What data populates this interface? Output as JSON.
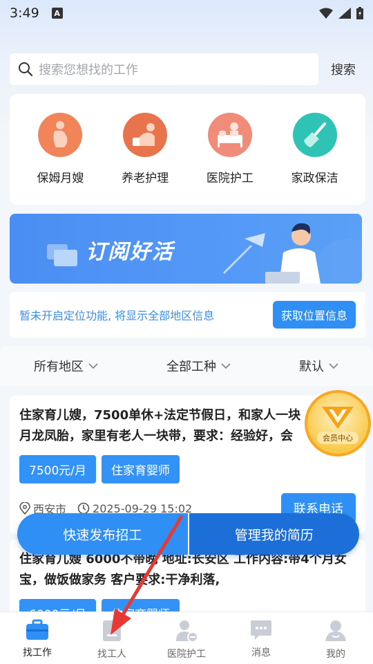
{
  "status": {
    "time": "3:49",
    "notification_glyph": "A"
  },
  "search": {
    "placeholder": "搜索您想找的工作",
    "button_label": "搜索"
  },
  "categories": [
    {
      "label": "保姆月嫂",
      "icon": "pregnant-woman-icon",
      "color": "#f2845a"
    },
    {
      "label": "养老护理",
      "icon": "elderly-care-icon",
      "color": "#e7744c"
    },
    {
      "label": "医院护工",
      "icon": "hospital-bed-icon",
      "color": "#f28c7a"
    },
    {
      "label": "家政保洁",
      "icon": "broom-icon",
      "color": "#2fc3b6"
    }
  ],
  "banner": {
    "title": "订阅好活"
  },
  "location": {
    "message": "暂未开启定位功能, 将显示全部地区信息",
    "button_label": "获取位置信息"
  },
  "filters": [
    {
      "label": "所有地区"
    },
    {
      "label": "全部工种"
    },
    {
      "label": "默认"
    }
  ],
  "jobs": [
    {
      "title_line1": "住家育儿嫂，7500单休+法定节假日，和家人一块",
      "title_line2": "月龙凤胎，家里有老人一块带，要求：经验好，会",
      "tags": [
        "7500元/月",
        "住家育婴师"
      ],
      "location": "西安市",
      "time": "2025-09-29 15:02",
      "call_label": "联系电话"
    },
    {
      "title_line1": "住家育儿嫂 6000不带晚 地址:长安区 工作内容:带4个月女",
      "title_line2": "宝，做饭做家务 客户要求:干净利落,",
      "tags": [
        "6000元/月",
        "住家育婴师"
      ]
    }
  ],
  "vip": {
    "label": "会员中心"
  },
  "actions": {
    "post_label": "快速发布招工",
    "resume_label": "管理我的简历"
  },
  "tabs": [
    {
      "label": "找工作",
      "icon": "briefcase-icon"
    },
    {
      "label": "找工人",
      "icon": "worker-card-icon"
    },
    {
      "label": "医院护工",
      "icon": "nurse-icon"
    },
    {
      "label": "消息",
      "icon": "chat-icon"
    },
    {
      "label": "我的",
      "icon": "user-icon"
    }
  ],
  "colors": {
    "primary": "#2f8ff5",
    "primary_dark": "#1c6fd8",
    "accent_orange": "#f9a825",
    "arrow": "#e53935"
  }
}
